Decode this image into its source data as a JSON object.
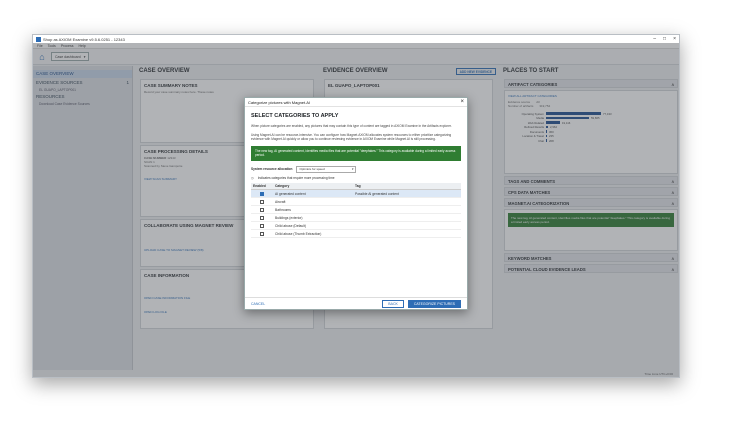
{
  "window": {
    "title": "Shop as AXIOM Examine v9.5.6.0251 - 12343"
  },
  "menu": [
    "File",
    "Tools",
    "Process",
    "Help"
  ],
  "toolbar": {
    "case_dashboard": "Case dashboard"
  },
  "left_nav": {
    "case_overview": "CASE OVERVIEW",
    "evidence_sources": "EVIDENCE SOURCES",
    "evidence_sources_count": "1",
    "evidence_sub": "EL GUAPO_LAPTOP001",
    "resources": "RESOURCES",
    "resources_sub": "Download Case Evidence Sources"
  },
  "case_overview": {
    "heading": "CASE OVERVIEW",
    "summary_title": "CASE SUMMARY NOTES",
    "summary_text": "Record your case summary notes here. These notes",
    "processing_title": "CASE PROCESSING DETAILS",
    "case_number_label": "CASE NUMBER",
    "case_number": "12343",
    "scan_label": "SCAN 1",
    "scanned_by_label": "Scanned by",
    "scanned_by": "Steve Gamporie",
    "view_scan": "VIEW SCAN SUMMARY",
    "collaborate_title": "COLLABORATE USING MAGNET REVIEW",
    "collaborate_link": "UPLOAD CASE TO MAGNET REVIEW (5/8)",
    "case_info_title": "CASE INFORMATION",
    "case_info_link": "OPEN CASE INFORMATION FILE",
    "open_log": "OPEN LOG FILE"
  },
  "evidence_overview": {
    "heading": "EVIDENCE OVERVIEW",
    "add_new": "ADD NEW EVIDENCE",
    "device": "EL GUAPO_LAPTOP001"
  },
  "places": {
    "heading": "PLACES TO START",
    "artifact_categories": "ARTIFACT CATEGORIES",
    "view_all": "VIEW ALL ARTIFACT CATEGORIES",
    "evidence_source_label": "Evidence source",
    "evidence_source_value": "All",
    "num_artifacts_label": "Number of artifacts",
    "num_artifacts": "319,754",
    "tags_comments": "TAGS AND COMMENTS",
    "cps": "CPS DATA MATCHES",
    "magnetai": "MAGNET.AI CATEGORIZATION",
    "magnetai_text": "The new tag, AI generated content, identifies media files that are potential \"deepfakes.\" This category is available during a limited early access period.",
    "keyword": "KEYWORD MATCHES",
    "cloud": "POTENTIAL CLOUD EVIDENCE LEADS"
  },
  "artifact_bars": [
    {
      "label": "Operating System",
      "value": 77433,
      "text": "77,433"
    },
    {
      "label": "Media",
      "value": 59865,
      "text": "59,865"
    },
    {
      "label": "Web Related",
      "value": 19116,
      "text": "19,116"
    },
    {
      "label": "Refined Results",
      "value": 2962,
      "text": "2,962"
    },
    {
      "label": "Documents",
      "value": 360,
      "text": "360"
    },
    {
      "label": "Location & Travel",
      "value": 235,
      "text": "235"
    },
    {
      "label": "Chat",
      "value": 208,
      "text": "208"
    }
  ],
  "dialog": {
    "title": "Categorize pictures with Magnet.AI",
    "heading": "SELECT CATEGORIES TO APPLY",
    "para1": "When picture categories are enabled, any pictures that may contain this type of content are tagged in AXIOM Examine in the Artifacts explorer.",
    "para2": "Using Magnet.AI can be resource-intensive. You can configure how Magnet.AXIOM allocates system resources to either prioritize categorizing evidence with Magnet.AI quickly or allow you to continue reviewing evidence in AXIOM Examine while Magnet.AI is still processing.",
    "notice": "The new tag, AI generated content, identifies media files that are potential \"deepfakes.\" This category is available during a limited early access period.",
    "resource_label": "System resource allocation",
    "resource_value": "Optimize for speed",
    "more_time": "Indicates categories that require more processing time",
    "col_enabled": "Enabled",
    "col_category": "Category",
    "col_tag": "Tag",
    "rows": [
      {
        "enabled": true,
        "category": "AI generated content",
        "tag": "Possible AI generated content"
      },
      {
        "enabled": false,
        "category": "Aircraft",
        "tag": ""
      },
      {
        "enabled": false,
        "category": "Bathrooms",
        "tag": ""
      },
      {
        "enabled": false,
        "category": "Buildings (exterior)",
        "tag": ""
      },
      {
        "enabled": false,
        "category": "Child abuse (Default)",
        "tag": ""
      },
      {
        "enabled": false,
        "category": "Child abuse (Thumb Extraction)",
        "tag": ""
      }
    ],
    "cancel": "CANCEL",
    "back": "BACK",
    "categorize": "CATEGORIZE PICTURES"
  },
  "status": "Time zone   UTC+0:00"
}
